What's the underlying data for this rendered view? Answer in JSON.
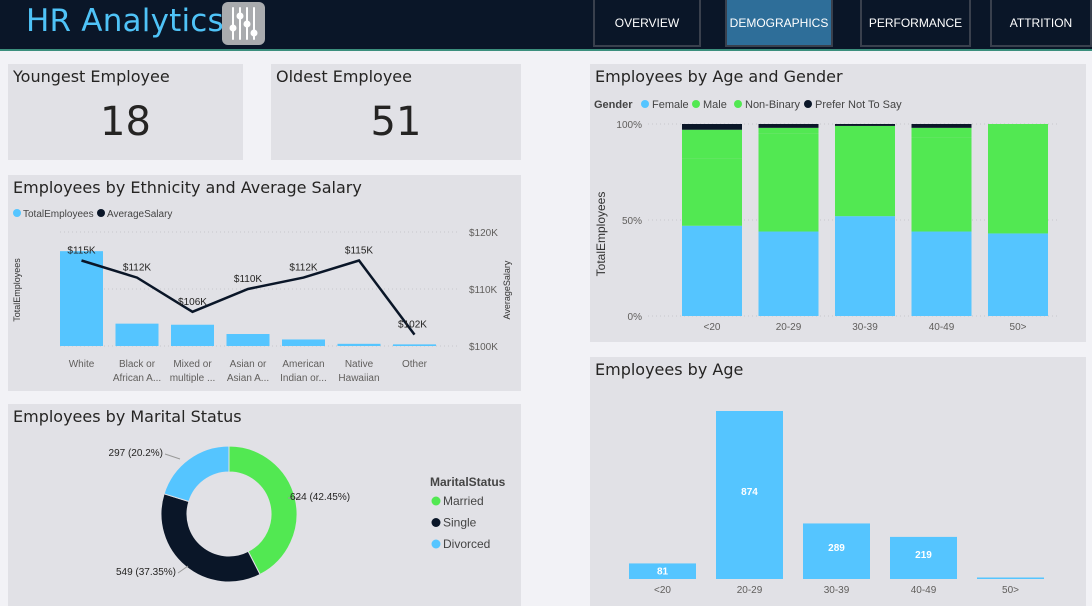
{
  "header": {
    "title": "HR Analytics",
    "logo_icon": "sliders-icon",
    "tabs": [
      {
        "label": "OVERVIEW",
        "active": false
      },
      {
        "label": "DEMOGRAPHICS",
        "active": true
      },
      {
        "label": "PERFORMANCE",
        "active": false
      },
      {
        "label": "ATTRITION",
        "active": false
      }
    ]
  },
  "kpis": {
    "youngest": {
      "title": "Youngest Employee",
      "value": "18"
    },
    "oldest": {
      "title": "Oldest Employee",
      "value": "51"
    }
  },
  "colors": {
    "blue": "#55c5ff",
    "green": "#52e852",
    "navy": "#0a1628",
    "header": "#0a1628",
    "active_tab": "#2e6e99"
  },
  "chart_data": [
    {
      "id": "ethnicity",
      "type": "bar",
      "title": "Employees by Ethnicity and Average Salary",
      "legend": [
        "TotalEmployees",
        "AverageSalary"
      ],
      "ylabel": "TotalEmployees",
      "y2label": "AverageSalary",
      "categories": [
        [
          "White"
        ],
        [
          "Black or",
          "African A..."
        ],
        [
          "Mixed or",
          "multiple ..."
        ],
        [
          "Asian or",
          "Asian A..."
        ],
        [
          "American",
          "Indian or..."
        ],
        [
          "Native",
          "Hawaiian"
        ],
        [
          "Other"
        ]
      ],
      "series": [
        {
          "name": "TotalEmployees",
          "values": [
            870,
            205,
            195,
            110,
            60,
            20,
            15
          ]
        },
        {
          "name": "AverageSalary",
          "values": [
            115,
            112,
            106,
            110,
            112,
            115,
            102
          ],
          "labels": [
            "$115K",
            "$112K",
            "$106K",
            "$110K",
            "$112K",
            "$115K",
            "$102K"
          ]
        }
      ],
      "y2_ticks": [
        "$120K",
        "$110K",
        "$100K"
      ],
      "y2lim": [
        100,
        120
      ]
    },
    {
      "id": "marital",
      "type": "pie",
      "title": "Employees by Marital Status",
      "legend_title": "MaritalStatus",
      "slices": [
        {
          "name": "Married",
          "value": 624,
          "label": "624 (42.45%)",
          "color": "#52e852"
        },
        {
          "name": "Single",
          "value": 549,
          "label": "549 (37.35%)",
          "color": "#0a1628"
        },
        {
          "name": "Divorced",
          "value": 297,
          "label": "297 (20.2%)",
          "color": "#55c5ff"
        }
      ]
    },
    {
      "id": "age_gender",
      "type": "bar",
      "stacked": "percent",
      "title": "Employees by Age and Gender",
      "legend_title": "Gender",
      "legend": [
        "Female",
        "Male",
        "Non-Binary",
        "Prefer Not To Say"
      ],
      "ylabel": "TotalEmployees",
      "y_ticks": [
        "100%",
        "50%",
        "0%"
      ],
      "categories": [
        "<20",
        "20-29",
        "30-39",
        "40-49",
        "50>"
      ],
      "series": [
        {
          "name": "Female",
          "values": [
            47,
            44,
            52,
            44,
            43
          ]
        },
        {
          "name": "Male",
          "values": [
            35,
            51,
            47,
            49,
            57
          ]
        },
        {
          "name": "Non-Binary",
          "values": [
            15,
            3,
            0,
            5,
            0
          ]
        },
        {
          "name": "Prefer Not To Say",
          "values": [
            3,
            2,
            1,
            2,
            0
          ]
        }
      ]
    },
    {
      "id": "age",
      "type": "bar",
      "title": "Employees by Age",
      "categories": [
        "<20",
        "20-29",
        "30-39",
        "40-49",
        "50>"
      ],
      "values": [
        81,
        874,
        289,
        219,
        7
      ],
      "labels": [
        "81",
        "874",
        "289",
        "219",
        ""
      ]
    }
  ]
}
